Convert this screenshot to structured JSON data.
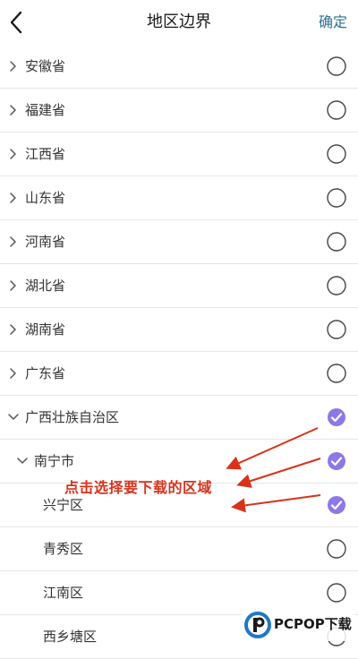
{
  "header": {
    "title": "地区边界",
    "confirm_label": "确定"
  },
  "icons": {
    "back": "chevron-left-icon",
    "collapsed": "chevron-right-icon",
    "expanded": "chevron-down-icon",
    "unchecked": "radio-empty-icon",
    "checked": "check-circle-icon"
  },
  "colors": {
    "accent": "#8c78e6",
    "confirm": "#2f6f8f",
    "annotation": "#d9321c"
  },
  "regions": [
    {
      "label": "安徽省",
      "level": 0,
      "state": "collapsed",
      "checked": false
    },
    {
      "label": "福建省",
      "level": 0,
      "state": "collapsed",
      "checked": false
    },
    {
      "label": "江西省",
      "level": 0,
      "state": "collapsed",
      "checked": false
    },
    {
      "label": "山东省",
      "level": 0,
      "state": "collapsed",
      "checked": false
    },
    {
      "label": "河南省",
      "level": 0,
      "state": "collapsed",
      "checked": false
    },
    {
      "label": "湖北省",
      "level": 0,
      "state": "collapsed",
      "checked": false
    },
    {
      "label": "湖南省",
      "level": 0,
      "state": "collapsed",
      "checked": false
    },
    {
      "label": "广东省",
      "level": 0,
      "state": "collapsed",
      "checked": false
    },
    {
      "label": "广西壮族自治区",
      "level": 0,
      "state": "expanded",
      "checked": true
    },
    {
      "label": "南宁市",
      "level": 1,
      "state": "expanded",
      "checked": true
    },
    {
      "label": "兴宁区",
      "level": 2,
      "state": "leaf",
      "checked": true
    },
    {
      "label": "青秀区",
      "level": 2,
      "state": "leaf",
      "checked": false
    },
    {
      "label": "江南区",
      "level": 2,
      "state": "leaf",
      "checked": false
    },
    {
      "label": "西乡塘区",
      "level": 2,
      "state": "leaf",
      "checked": false
    }
  ],
  "annotation": {
    "text": "点击选择要下载的区域"
  },
  "watermark": {
    "text": "PCPOP下载"
  }
}
